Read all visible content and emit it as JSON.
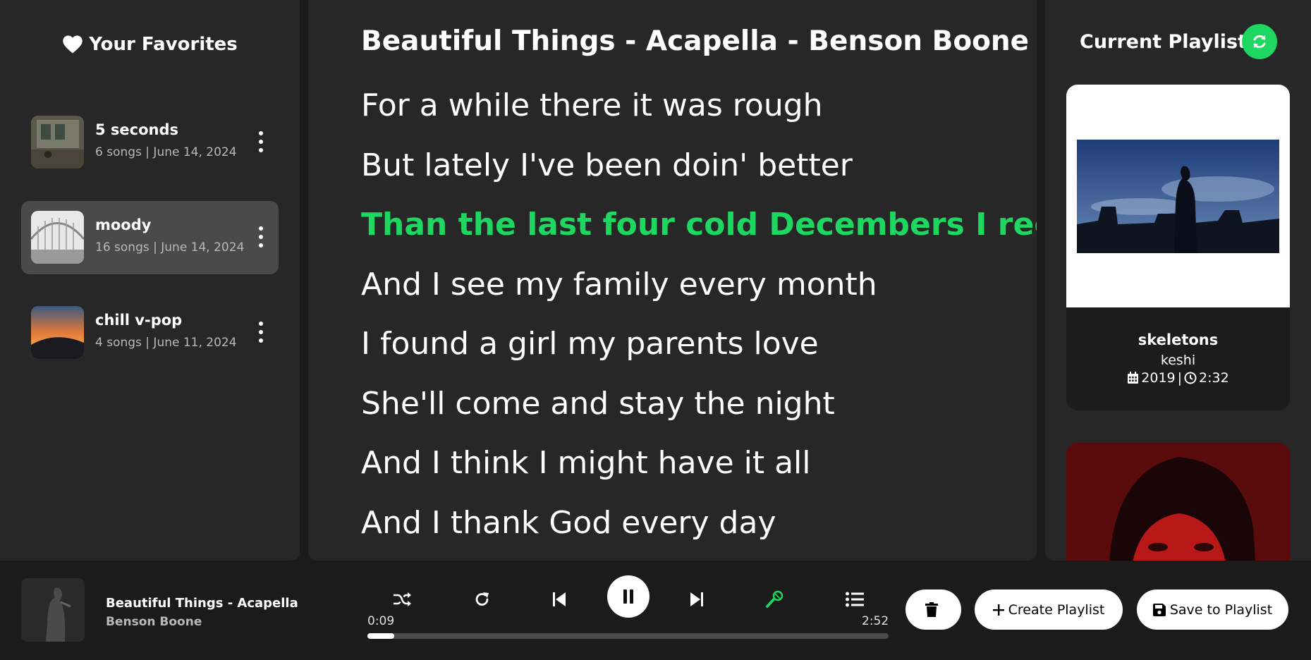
{
  "favorites": {
    "title": "Your Favorites",
    "playlists": [
      {
        "name": "5 seconds",
        "meta": "6 songs | June 14, 2024"
      },
      {
        "name": "moody",
        "meta": "16 songs | June 14, 2024"
      },
      {
        "name": "chill v-pop",
        "meta": "4 songs | June 11, 2024"
      }
    ]
  },
  "lyrics": {
    "song_title": "Beautiful Things - Acapella - Benson Boone",
    "current_index": 2,
    "lines": [
      "For a while there it was rough",
      "But lately I've been doin' better",
      "Than the last four cold Decembers I recall",
      "And I see my family every month",
      "I found a girl my parents love",
      "She'll come and stay the night",
      "And I think I might have it all",
      "And I thank God every day"
    ]
  },
  "current_playlist": {
    "title": "Current Playlist",
    "cards": [
      {
        "name": "skeletons",
        "artist": "keshi",
        "year": "2019",
        "duration": "2:32"
      }
    ]
  },
  "player": {
    "title": "Beautiful Things - Acapella",
    "artist": "Benson Boone",
    "elapsed": "0:09",
    "total": "2:52",
    "progress": 0.052,
    "delete_label": "",
    "create_label": "Create Playlist",
    "save_label": "Save to Playlist",
    "accent": "#1ed760"
  }
}
